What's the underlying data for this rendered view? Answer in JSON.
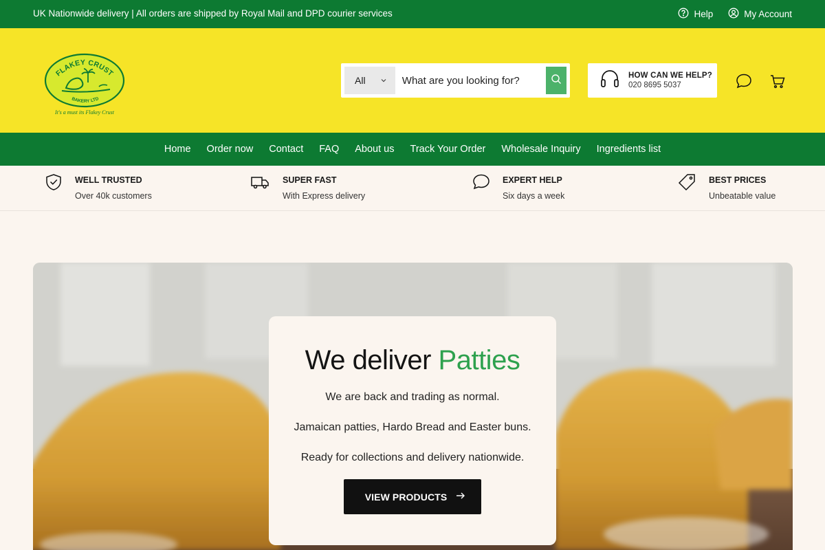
{
  "topbar": {
    "message": "UK Nationwide delivery | All orders are shipped by Royal Mail and DPD courier services",
    "help_label": "Help",
    "account_label": "My Account"
  },
  "logo": {
    "top_text": "FLAKEY CRUST",
    "bottom_text": "BAKERY LTD",
    "tagline": "It's a must its Flakey Crust"
  },
  "search": {
    "category": "All",
    "placeholder": "What are you looking for?"
  },
  "help_box": {
    "title": "HOW CAN WE HELP?",
    "phone": "020 8695 5037"
  },
  "nav": {
    "items": [
      "Home",
      "Order now",
      "Contact",
      "FAQ",
      "About us",
      "Track Your Order",
      "Wholesale Inquiry",
      "Ingredients list"
    ]
  },
  "features": [
    {
      "icon": "shield-check-icon",
      "title": "WELL TRUSTED",
      "subtitle": "Over 40k customers"
    },
    {
      "icon": "truck-icon",
      "title": "SUPER FAST",
      "subtitle": "With Express delivery"
    },
    {
      "icon": "chat-bubble-icon",
      "title": "EXPERT HELP",
      "subtitle": "Six days a week"
    },
    {
      "icon": "price-tag-icon",
      "title": "BEST PRICES",
      "subtitle": "Unbeatable value"
    }
  ],
  "hero": {
    "heading_prefix": "We deliver",
    "heading_accent": "Patties",
    "line1": "We are back and trading as normal.",
    "line2": "Jamaican patties, Hardo Bread and Easter buns.",
    "line3": "Ready for collections and delivery nationwide.",
    "button_label": "VIEW PRODUCTS"
  },
  "colors": {
    "brand_green": "#0d7a32",
    "header_yellow": "#f6e427",
    "accent_green": "#2ea14e",
    "search_button": "#4cb26a"
  }
}
